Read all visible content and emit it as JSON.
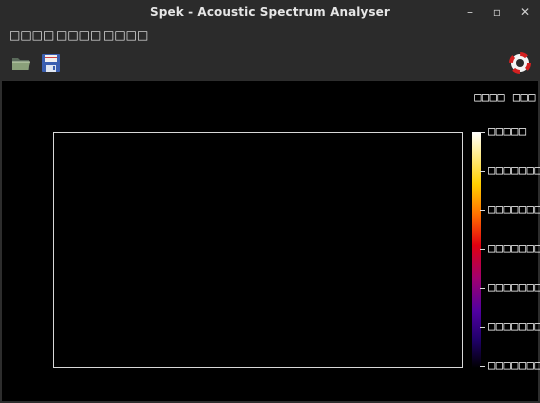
{
  "window": {
    "title": "Spek - Acoustic Spectrum Analyser"
  },
  "menubar": {
    "items": [
      "□□□□",
      "□□□□",
      "□□□□"
    ]
  },
  "toolbar": {
    "open_icon": "folder-open-icon",
    "save_icon": "save-icon",
    "help_icon": "help-lifebuoy-icon"
  },
  "viewer": {
    "header": "□□□□ □□□",
    "scale_labels": [
      "□□□□□",
      "□□□□□□□",
      "□□□□□□□",
      "□□□□□□□",
      "□□□□□□□",
      "□□□□□□□",
      "□□□□□□□"
    ]
  },
  "colors": {
    "background": "#000000",
    "frame": "#d8d8d8",
    "chrome": "#2b2b2b"
  }
}
